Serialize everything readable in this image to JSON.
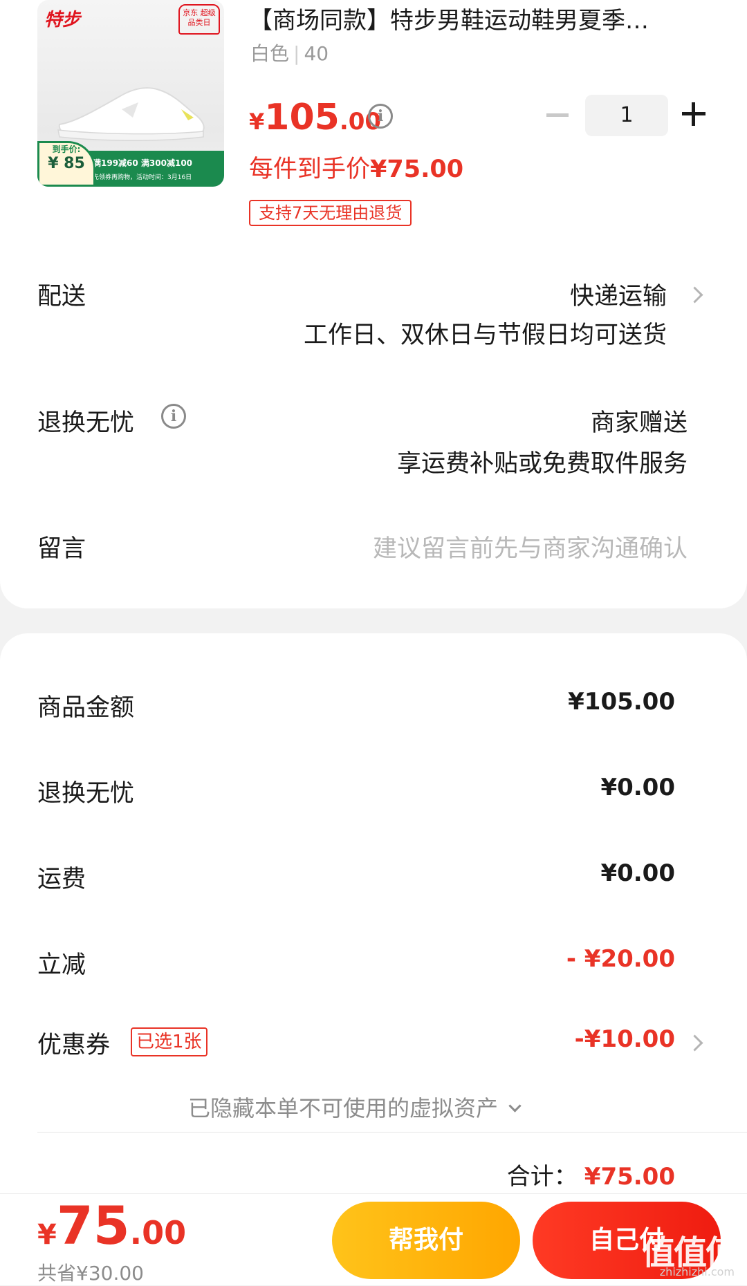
{
  "product": {
    "thumbnail": {
      "brand_logo": "特步",
      "seal": "京东 超级品类日",
      "arrive_label": "到手价:",
      "arrive_price": "¥ 85",
      "band_text": "满199减60  满300减100",
      "band_sub": "先领券再购物，活动时间：3月16日"
    },
    "title": "【商场同款】特步男鞋运动鞋男夏季…",
    "spec_color": "白色",
    "spec_size": "40",
    "price_currency": "¥",
    "price_int": "105",
    "price_dec": ".00",
    "quantity": "1",
    "per_unit_label": "每件到手价",
    "per_unit_price": "¥75.00",
    "return_tag": "支持7天无理由退货"
  },
  "delivery": {
    "label": "配送",
    "method": "快递运输",
    "note": "工作日、双休日与节假日均可送货"
  },
  "worry_free": {
    "label": "退换无忧",
    "value": "商家赠送",
    "note": "享运费补贴或免费取件服务"
  },
  "message": {
    "label": "留言",
    "placeholder": "建议留言前先与商家沟通确认"
  },
  "summary": {
    "goods_label": "商品金额",
    "goods_value": "¥105.00",
    "worry_label": "退换无忧",
    "worry_value": "¥0.00",
    "shipping_label": "运费",
    "shipping_value": "¥0.00",
    "discount_label": "立减",
    "discount_value": "- ¥20.00",
    "coupon_label": "优惠券",
    "coupon_tag": "已选1张",
    "coupon_value": "-¥10.00",
    "hidden_assets": "已隐藏本单不可使用的虚拟资产",
    "total_label": "合计：",
    "total_value": "¥75.00"
  },
  "bottom_bar": {
    "price_currency": "¥",
    "price_int": "75",
    "price_dec": ".00",
    "saved": "共省¥30.00",
    "help_pay": "帮我付",
    "self_pay": "自己付",
    "watermark": "值值值",
    "watermark_sub": "zhizhizhi.com"
  },
  "colors": {
    "accent_red": "#e93326",
    "help_button": "#ffb300",
    "pay_button": "#f5261a"
  },
  "icons": [
    "info-icon",
    "chevron-right-icon",
    "minus-icon",
    "plus-icon",
    "chevron-down-icon"
  ]
}
